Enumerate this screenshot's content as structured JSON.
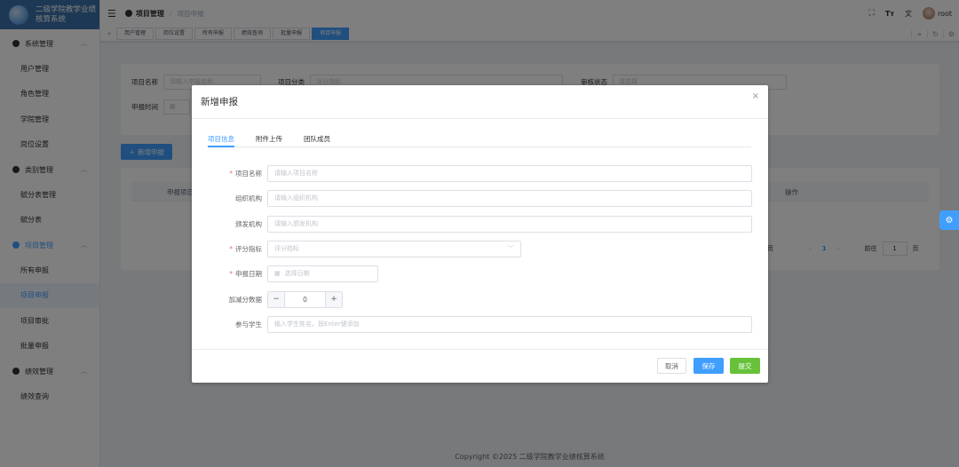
{
  "app": {
    "logo_line1": "二级学院教学业绩",
    "logo_line2": "核算系统"
  },
  "sidebar": {
    "groups": [
      {
        "label": "系统管理",
        "items": [
          "用户管理",
          "角色管理",
          "学院管理",
          "岗位设置"
        ]
      },
      {
        "label": "类别管理",
        "items": [
          "赋分表管理",
          "赋分表"
        ]
      },
      {
        "label": "项目管理",
        "items": [
          "所有申报",
          "项目申报",
          "项目审批",
          "批量申报"
        ]
      },
      {
        "label": "绩效管理",
        "items": [
          "绩效查询"
        ]
      }
    ]
  },
  "header": {
    "breadcrumb_1": "项目管理",
    "breadcrumb_sep": "/",
    "breadcrumb_2": "项目申报",
    "user_name": "root"
  },
  "tags": [
    "用户管理",
    "岗位设置",
    "所有申报",
    "绩效查询",
    "批量申报",
    "项目申报"
  ],
  "search": {
    "name_label": "项目名称",
    "name_placeholder": "请输入申报名称",
    "category_label": "项目分类",
    "category_placeholder": "评分指标",
    "status_label": "审核状态",
    "status_placeholder": "请选择",
    "time_label": "申报时间"
  },
  "toolbar": {
    "add_label": "新增申报"
  },
  "table": {
    "col_name": "申报项目",
    "col_ops": "操作"
  },
  "pager": {
    "per_page_suffix": "页",
    "current_page": "1",
    "goto_label": "前往",
    "goto_value": "1",
    "page_unit": "页"
  },
  "footer": {
    "copyright": "Copyright ©2025 二级学院教学业绩核算系统"
  },
  "dialog": {
    "title": "新增申报",
    "tabs": [
      "项目信息",
      "附件上传",
      "团队成员"
    ],
    "fields": {
      "project_name": {
        "label": "项目名称",
        "placeholder": "请输入项目名称",
        "required": true
      },
      "org": {
        "label": "组织机构",
        "placeholder": "请输入组织机构",
        "required": false
      },
      "issuer": {
        "label": "颁发机构",
        "placeholder": "请输入颁发机构",
        "required": false
      },
      "indicator": {
        "label": "评分指标",
        "placeholder": "评分指标",
        "required": true
      },
      "date": {
        "label": "申报日期",
        "placeholder": "选择日期",
        "required": true
      },
      "bonus": {
        "label": "加减分数据",
        "value": "0"
      },
      "students": {
        "label": "参与学生",
        "placeholder": "输入学生姓名，按Enter键添加"
      }
    },
    "buttons": {
      "cancel": "取消",
      "save": "保存",
      "submit": "提交"
    }
  },
  "colors": {
    "primary": "#409eff",
    "success": "#67c23a",
    "sidebar_header": "#3a71a8"
  }
}
